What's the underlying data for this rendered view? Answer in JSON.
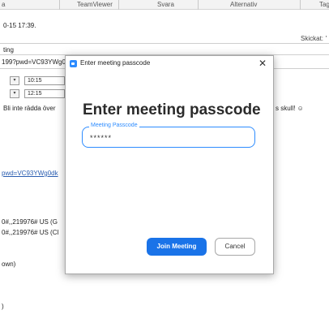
{
  "ribbon": {
    "item_partial": "a",
    "teamviewer": "TeamViewer",
    "svara": "Svara",
    "alternativ": "Alternativ",
    "tag_partial": "Tag"
  },
  "email": {
    "sent_fragment": "0-15 17:39.",
    "skickat_label": "Skickat:",
    "skickat_value": "'",
    "subject_fragment": "ting",
    "url_fragment": "199?pwd=VC93YWg0",
    "start_time": "10:15",
    "end_time": "12:15",
    "body_left": "Bli inte rädda över",
    "body_right": "s skull! ☺",
    "link_fragment": "pwd=VC93YWg0dk",
    "dial_line_1": "0#,,219976# US (G",
    "dial_line_2": "0#,,219976# US (Cl",
    "own_fragment": "own)",
    "paren_fragment": ")"
  },
  "dialog": {
    "window_title": "Enter meeting passcode",
    "close_glyph": "✕",
    "heading": "Enter meeting passcode",
    "field_label": "Meeting Passcode",
    "field_value": "******",
    "join_label": "Join Meeting",
    "cancel_label": "Cancel"
  },
  "colors": {
    "accent": "#2d8cff",
    "join_button": "#1a73e8"
  }
}
